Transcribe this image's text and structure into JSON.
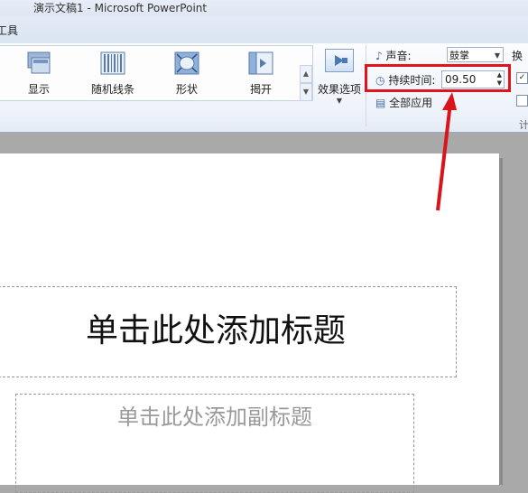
{
  "window": {
    "title": "演示文稿1 - Microsoft PowerPoint"
  },
  "tabs": {
    "tools_label": "工具"
  },
  "effects": [
    {
      "label": "显示",
      "icon": "show-effect-icon"
    },
    {
      "label": "随机线条",
      "icon": "random-bars-icon"
    },
    {
      "label": "形状",
      "icon": "shape-icon"
    },
    {
      "label": "揭开",
      "icon": "uncover-icon"
    }
  ],
  "effect_options": {
    "label": "效果选项",
    "icon": "effect-options-icon"
  },
  "timing": {
    "sound_label": "声音:",
    "sound_value": "鼓掌",
    "duration_label": "持续时间:",
    "duration_value": "09.50",
    "apply_all_label": "全部应用",
    "right_col_label": "换",
    "group_label": "计"
  },
  "slide": {
    "title_placeholder": "单击此处添加标题",
    "subtitle_placeholder": "单击此处添加副标题"
  },
  "colors": {
    "highlight": "#e0141b",
    "ribbon_bg": "#eef3fa"
  }
}
